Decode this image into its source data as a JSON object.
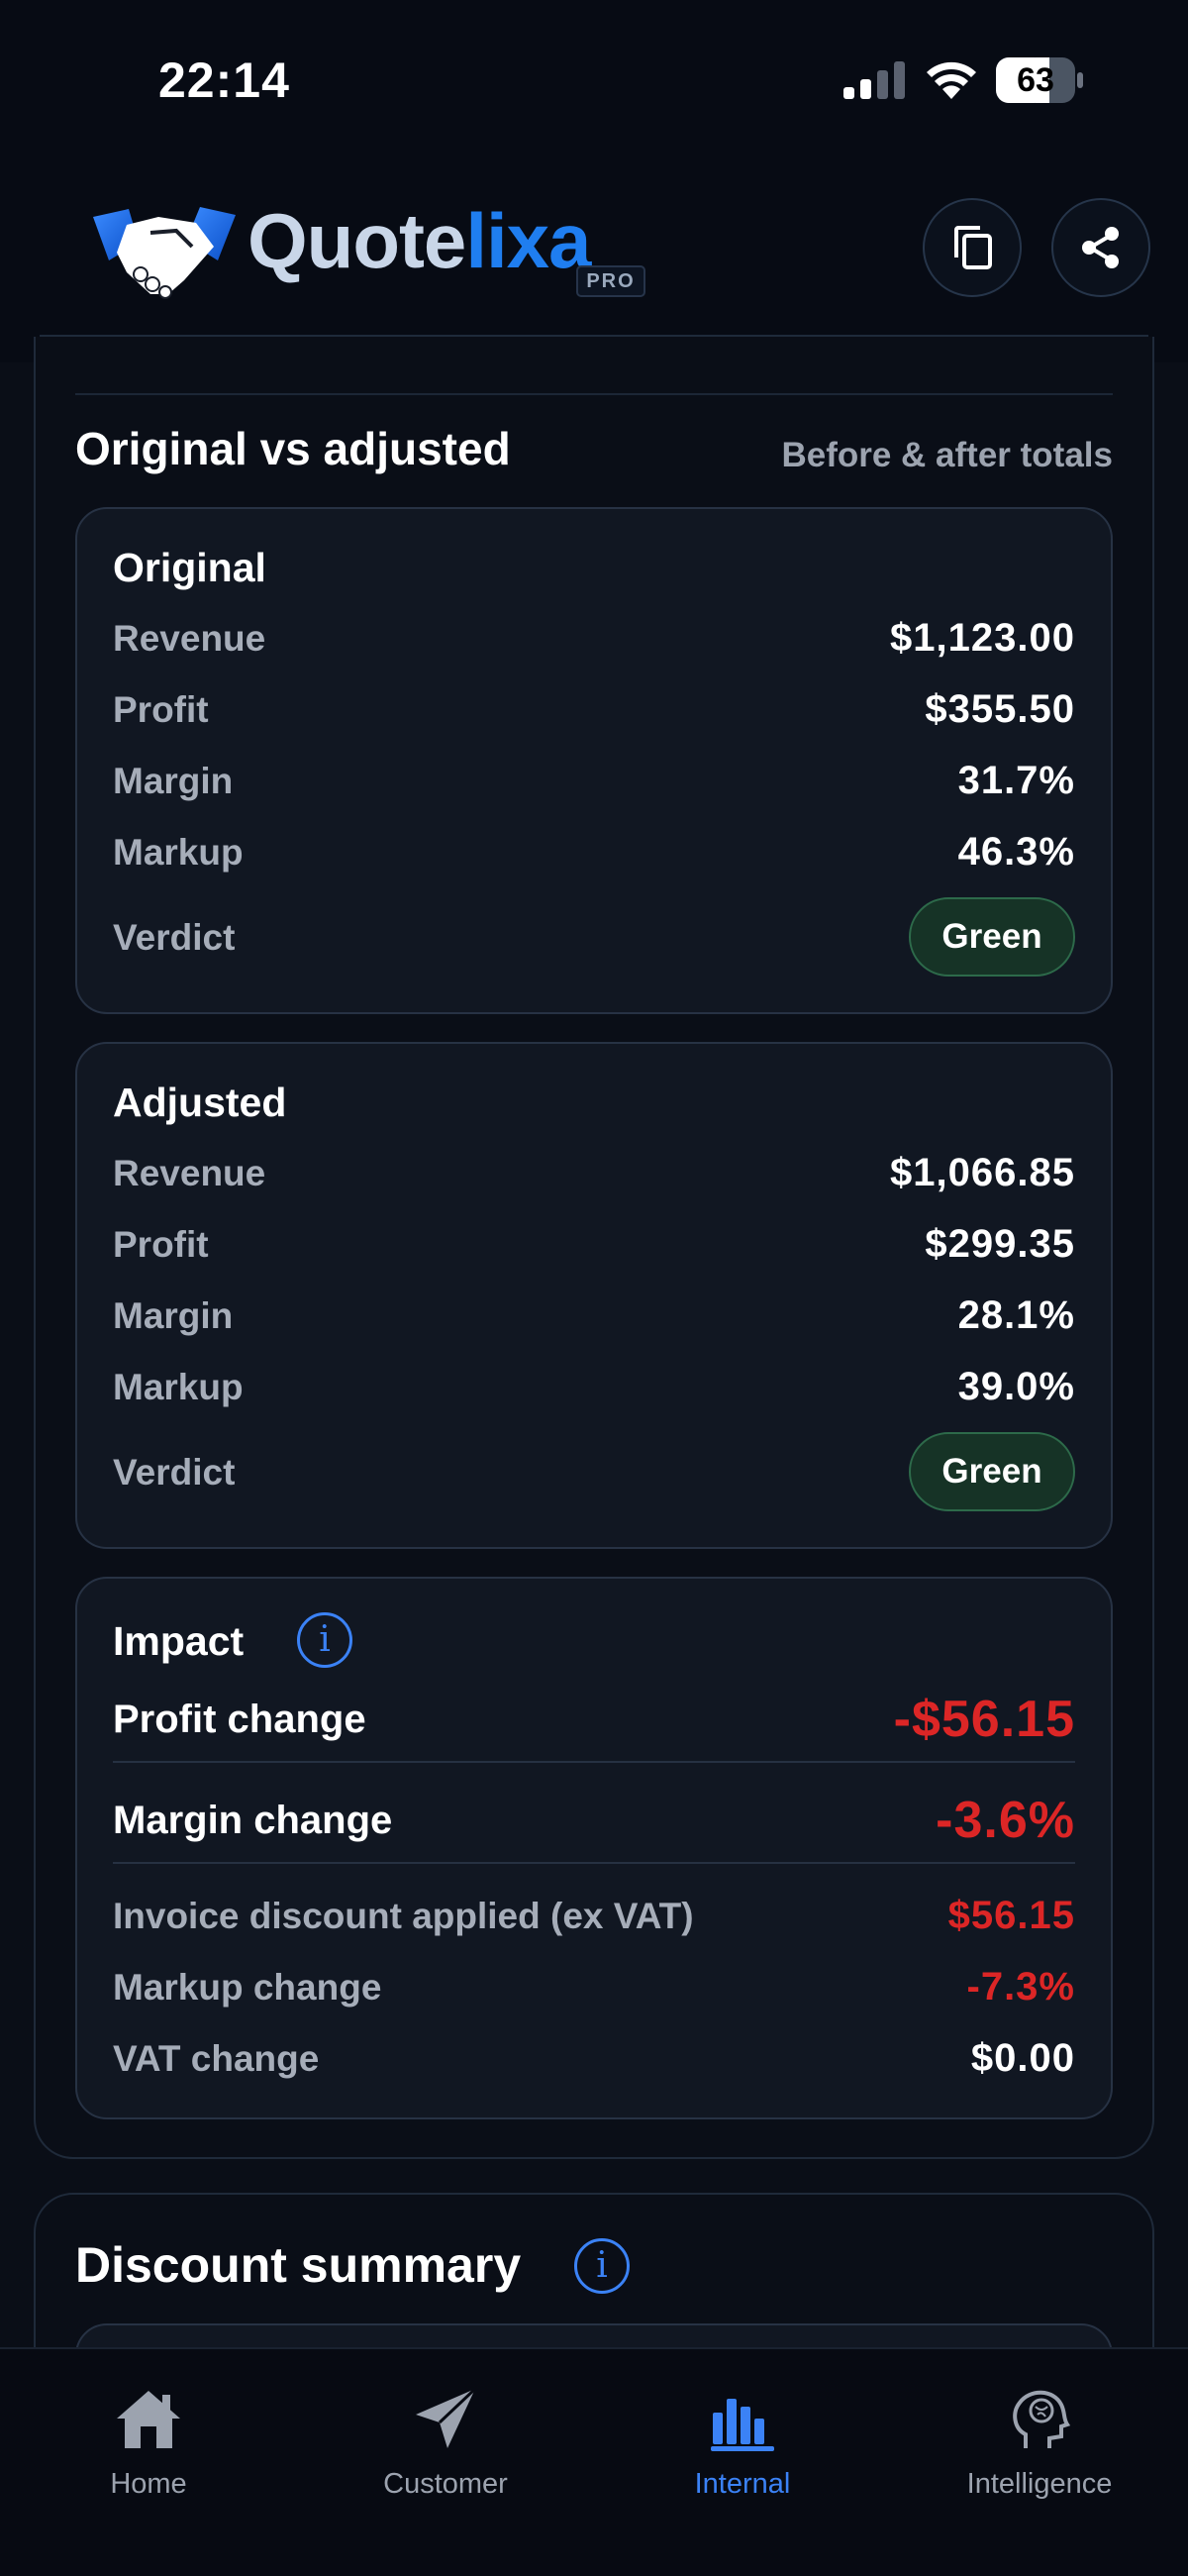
{
  "status_bar": {
    "time": "22:14",
    "battery": "63"
  },
  "header": {
    "logo_part1": "Quote",
    "logo_part2": "lixa",
    "badge": "PRO"
  },
  "section": {
    "title": "Original vs adjusted",
    "subtitle": "Before & after totals"
  },
  "original": {
    "title": "Original",
    "rows": [
      {
        "label": "Revenue",
        "value": "$1,123.00"
      },
      {
        "label": "Profit",
        "value": "$355.50"
      },
      {
        "label": "Margin",
        "value": "31.7%"
      },
      {
        "label": "Markup",
        "value": "46.3%"
      }
    ],
    "verdict_label": "Verdict",
    "verdict": "Green"
  },
  "adjusted": {
    "title": "Adjusted",
    "rows": [
      {
        "label": "Revenue",
        "value": "$1,066.85"
      },
      {
        "label": "Profit",
        "value": "$299.35"
      },
      {
        "label": "Margin",
        "value": "28.1%"
      },
      {
        "label": "Markup",
        "value": "39.0%"
      }
    ],
    "verdict_label": "Verdict",
    "verdict": "Green"
  },
  "impact": {
    "title": "Impact",
    "profit_change_label": "Profit change",
    "profit_change": "-$56.15",
    "margin_change_label": "Margin change",
    "margin_change": "-3.6%",
    "rows": [
      {
        "label": "Invoice discount applied (ex VAT)",
        "value": "$56.15"
      },
      {
        "label": "Markup change",
        "value": "-7.3%"
      },
      {
        "label": "VAT change",
        "value": "$0.00"
      }
    ]
  },
  "discount_summary": {
    "title": "Discount summary"
  },
  "tabs": [
    {
      "label": "Home",
      "icon": "home-icon"
    },
    {
      "label": "Customer",
      "icon": "send-icon"
    },
    {
      "label": "Internal",
      "icon": "bar-chart-icon",
      "active": true
    },
    {
      "label": "Intelligence",
      "icon": "brain-icon"
    }
  ],
  "colors": {
    "accent": "#3b82f6",
    "negative": "#dc2626",
    "verdict_green": "#163326"
  }
}
